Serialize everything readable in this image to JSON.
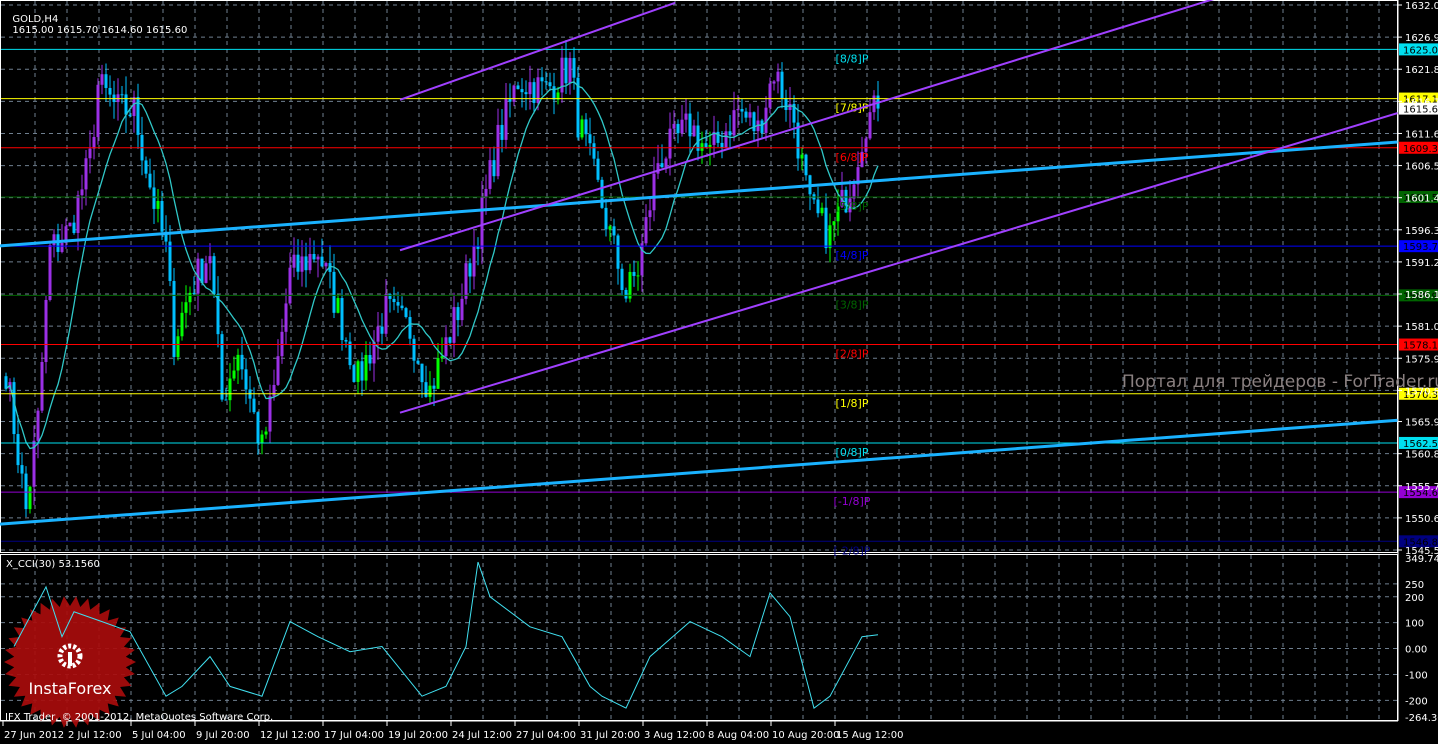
{
  "header": {
    "symbol": "GOLD,H4",
    "ohlc": "1615.00 1615.70 1614.60 1615.60"
  },
  "watermark": "Портал для трейдеров - ForTrader.ru",
  "copyright": "IFX Trader, © 2001-2012, MetaQuotes Software Corp.",
  "logo_text": "InstaForex",
  "colors": {
    "bull": "#9b30e6",
    "bear": "#00bfff",
    "bull_below_ma": "#00ff00",
    "ma": "#30c8c8",
    "trend": "#1ab2ff",
    "channel": "#a040ff",
    "cci": "#40e0f0",
    "grid": "#6f7f8f"
  },
  "chart_data": {
    "type": "candlestick",
    "title": "GOLD,H4",
    "price_axis_ticks": [
      "1632.05",
      "1626.95",
      "1621.85",
      "1616.75",
      "1611.65",
      "1606.55",
      "1601.45",
      "1596.35",
      "1591.25",
      "1586.15",
      "1581.05",
      "1575.95",
      "1570.85",
      "1565.90",
      "1560.80",
      "1555.70",
      "1550.60",
      "1545.50"
    ],
    "price_range": [
      1545.5,
      1632.05
    ],
    "current_price": "1615.60",
    "time_labels": [
      "27 Jun 2012",
      "2 Jul 12:00",
      "5 Jul 04:00",
      "9 Jul 20:00",
      "12 Jul 12:00",
      "17 Jul 04:00",
      "19 Jul 20:00",
      "24 Jul 12:00",
      "27 Jul 04:00",
      "31 Jul 20:00",
      "3 Aug 12:00",
      "8 Aug 04:00",
      "10 Aug 20:00",
      "15 Aug 12:00"
    ],
    "close_waypoints_bar_price": [
      [
        0,
        1574.1
      ],
      [
        5,
        1551.8
      ],
      [
        8,
        1566.1
      ],
      [
        11,
        1593.1
      ],
      [
        16,
        1596.3
      ],
      [
        21,
        1607.4
      ],
      [
        23,
        1619.3
      ],
      [
        28,
        1615.4
      ],
      [
        32,
        1615.4
      ],
      [
        36,
        1603.5
      ],
      [
        40,
        1593.1
      ],
      [
        42,
        1578.8
      ],
      [
        46,
        1586.8
      ],
      [
        51,
        1593.1
      ],
      [
        54,
        1569.3
      ],
      [
        58,
        1577.3
      ],
      [
        64,
        1561.4
      ],
      [
        67,
        1570.9
      ],
      [
        71,
        1589.2
      ],
      [
        78,
        1593.1
      ],
      [
        83,
        1583.6
      ],
      [
        88,
        1572.5
      ],
      [
        95,
        1583.6
      ],
      [
        101,
        1580.4
      ],
      [
        106,
        1570.9
      ],
      [
        113,
        1583.6
      ],
      [
        118,
        1596.3
      ],
      [
        123,
        1610.6
      ],
      [
        128,
        1620.1
      ],
      [
        135,
        1618.5
      ],
      [
        141,
        1622.5
      ],
      [
        143,
        1613.8
      ],
      [
        148,
        1602.7
      ],
      [
        155,
        1586.0
      ],
      [
        158,
        1590.0
      ],
      [
        163,
        1607.4
      ],
      [
        171,
        1613.0
      ],
      [
        176,
        1608.2
      ],
      [
        183,
        1615.4
      ],
      [
        188,
        1612.2
      ],
      [
        192,
        1621.7
      ],
      [
        197,
        1613.8
      ],
      [
        201,
        1599.5
      ],
      [
        206,
        1595.5
      ],
      [
        211,
        1603.5
      ],
      [
        215,
        1613.8
      ],
      [
        218,
        1615.6
      ]
    ],
    "murrey_levels": [
      {
        "label": "[8/8]P",
        "price": "1625.00",
        "color": "#00e0f0"
      },
      {
        "label": "[7/8]P",
        "price": "1617.19",
        "color": "#ffff00"
      },
      {
        "label": "[6/8]P",
        "price": "1609.38",
        "color": "#ff0000"
      },
      {
        "label": "[5/8]P",
        "price": "1601.56",
        "color": "#006400"
      },
      {
        "label": "[4/8]P",
        "price": "1593.75",
        "color": "#0000ff"
      },
      {
        "label": "[3/8]P",
        "price": "1585.94",
        "color": "#006400"
      },
      {
        "label": "[2/8]P",
        "price": "1578.13",
        "color": "#ff0000"
      },
      {
        "label": "[1/8]P",
        "price": "1570.31",
        "color": "#ffff00"
      },
      {
        "label": "[0/8]P",
        "price": "1562.50",
        "color": "#00e0f0"
      },
      {
        "label": "[-1/8]P",
        "price": "1554.69",
        "color": "#9400d3"
      },
      {
        "label": "[-2/8]P",
        "price": "1546.88",
        "color": "#000080"
      }
    ],
    "trend_lines_bar_price": [
      {
        "kind": "support-upper",
        "a": [
          -1.5,
          1593.8
        ],
        "b": [
          348,
          1610.3
        ]
      },
      {
        "kind": "support-lower",
        "a": [
          -1.5,
          1549.6
        ],
        "b": [
          348,
          1566.1
        ]
      }
    ],
    "channel_lines_bar_price": [
      {
        "kind": "channel-top",
        "a": [
          98.5,
          1617.0
        ],
        "b": [
          167.3,
          1632.4
        ]
      },
      {
        "kind": "channel-mid",
        "a": [
          98.5,
          1593.1
        ],
        "b": [
          303.5,
          1633.3
        ]
      },
      {
        "kind": "channel-bottom",
        "a": [
          98.5,
          1567.3
        ],
        "b": [
          348,
          1614.9
        ]
      }
    ],
    "indicator": {
      "name": "X_CCI(30) 53.1560",
      "axis_ticks": [
        "349.745",
        "250",
        "200",
        "100",
        "0.00",
        "-100",
        "-200",
        "-264.307"
      ],
      "range": [
        -264.307,
        349.745
      ],
      "waypoints_bar_value": [
        [
          2,
          8
        ],
        [
          10,
          238
        ],
        [
          14,
          46
        ],
        [
          17,
          142
        ],
        [
          24,
          104
        ],
        [
          31,
          65
        ],
        [
          40,
          -184
        ],
        [
          44,
          -146
        ],
        [
          51,
          -31
        ],
        [
          56,
          -146
        ],
        [
          64,
          -184
        ],
        [
          71,
          104
        ],
        [
          78,
          46
        ],
        [
          86,
          -12
        ],
        [
          94,
          8
        ],
        [
          104,
          -184
        ],
        [
          110,
          -146
        ],
        [
          115,
          8
        ],
        [
          118,
          334
        ],
        [
          121,
          200
        ],
        [
          131,
          84
        ],
        [
          139,
          46
        ],
        [
          146,
          -146
        ],
        [
          149,
          -184
        ],
        [
          155,
          -230
        ],
        [
          161,
          -31
        ],
        [
          171,
          104
        ],
        [
          179,
          46
        ],
        [
          186,
          -31
        ],
        [
          191,
          215
        ],
        [
          196,
          123
        ],
        [
          202,
          -230
        ],
        [
          206,
          -184
        ],
        [
          214,
          46
        ],
        [
          218,
          53.156
        ]
      ]
    }
  }
}
